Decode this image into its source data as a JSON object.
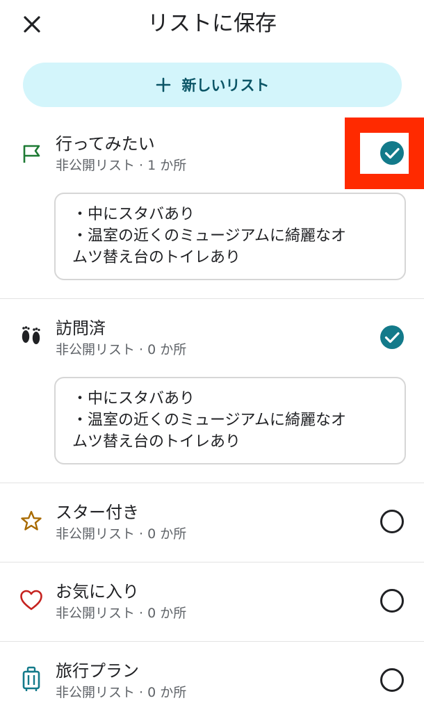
{
  "header": {
    "title": "リストに保存",
    "close_icon": "close-icon"
  },
  "new_list_button": {
    "label": "新しいリスト",
    "icon": "plus-icon"
  },
  "lists": [
    {
      "name": "行ってみたい",
      "subtitle": "非公開リスト · 1 か所",
      "icon": "flag-icon",
      "checked": true,
      "note_lines": [
        "・中にスタバあり",
        "・温室の近くのミュージアムに綺麗なオ",
        "ムツ替え台のトイレあり"
      ]
    },
    {
      "name": "訪問済",
      "subtitle": "非公開リスト · 0 か所",
      "icon": "footprints-icon",
      "checked": true,
      "note_lines": [
        "・中にスタバあり",
        "・温室の近くのミュージアムに綺麗なオ",
        "ムツ替え台のトイレあり"
      ]
    },
    {
      "name": "スター付き",
      "subtitle": "非公開リスト · 0 か所",
      "icon": "star-icon",
      "checked": false
    },
    {
      "name": "お気に入り",
      "subtitle": "非公開リスト · 0 か所",
      "icon": "heart-icon",
      "checked": false
    },
    {
      "name": "旅行プラン",
      "subtitle": "非公開リスト · 0 か所",
      "icon": "suitcase-icon",
      "checked": false
    }
  ],
  "colors": {
    "accent": "#137a8a",
    "new_list_bg": "#d3f5fb",
    "flag": "#1e7a34",
    "star": "#a86a00",
    "heart": "#c5221f",
    "suitcase": "#137a8a",
    "highlight": "#ff2a00"
  }
}
